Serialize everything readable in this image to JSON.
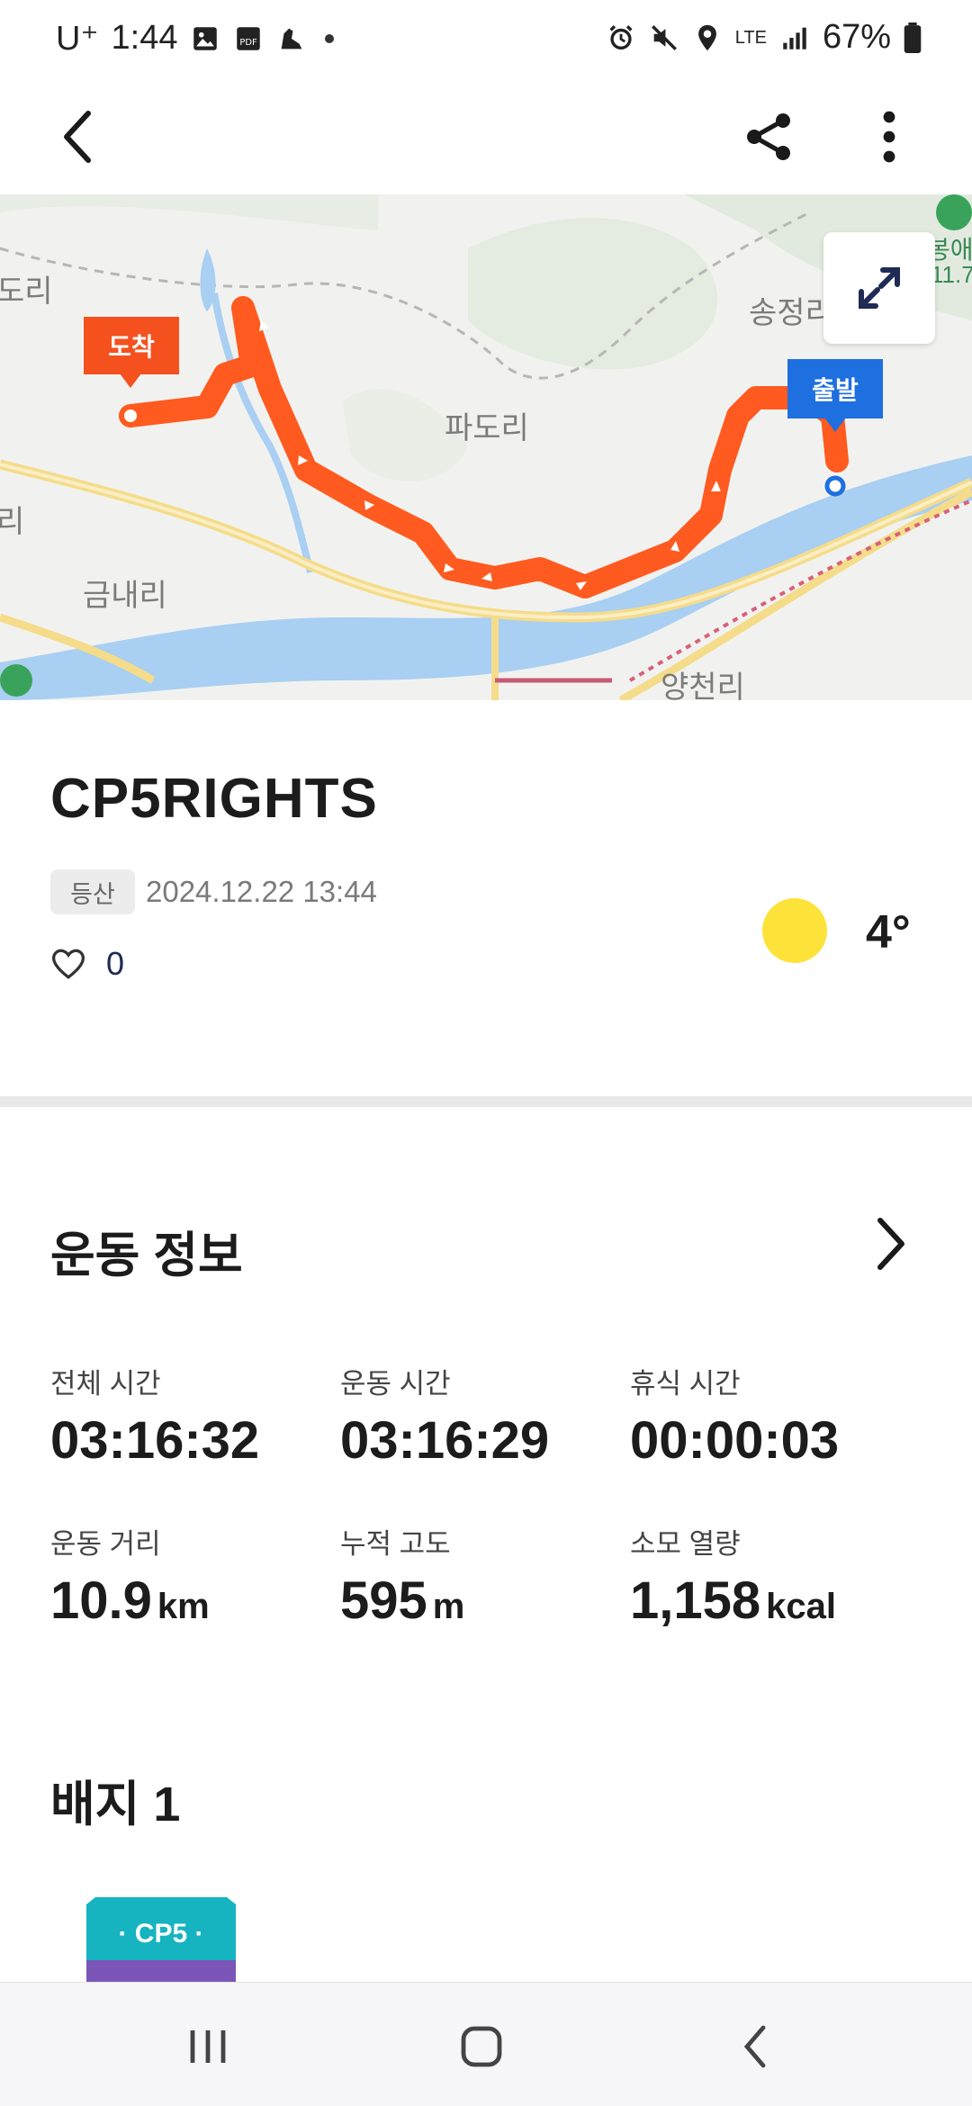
{
  "status_bar": {
    "carrier": "U⁺",
    "time": "1:44",
    "battery": "67%",
    "network": "LTE"
  },
  "map": {
    "labels": {
      "left_top": "도리",
      "left_mid": "리",
      "center": "파도리",
      "bottom_left": "금내리",
      "right_top": "송정리",
      "bottom_right": "양천리",
      "top_right_edge": "봉애산",
      "top_right_edge2": "11.7"
    },
    "arrive_marker": "도착",
    "start_marker": "출발",
    "colors": {
      "route": "#ff5a1f",
      "start": "#1e6fe0",
      "arrive": "#f4511e",
      "water": "#a9cff2"
    }
  },
  "activity": {
    "title": "CP5RIGHTS",
    "category": "등산",
    "datetime": "2024.12.22 13:44",
    "likes": "0",
    "temperature": "4°"
  },
  "exercise_info": {
    "title": "운동 정보",
    "stats": [
      {
        "label": "전체 시간",
        "value": "03:16:32",
        "unit": ""
      },
      {
        "label": "운동 시간",
        "value": "03:16:29",
        "unit": ""
      },
      {
        "label": "휴식 시간",
        "value": "00:00:03",
        "unit": ""
      },
      {
        "label": "운동 거리",
        "value": "10.9",
        "unit": "km"
      },
      {
        "label": "누적 고도",
        "value": "595",
        "unit": "m"
      },
      {
        "label": "소모 열량",
        "value": "1,158",
        "unit": "kcal"
      }
    ]
  },
  "badges": {
    "title": "배지 1",
    "badge_text": "· CP5 ·"
  }
}
